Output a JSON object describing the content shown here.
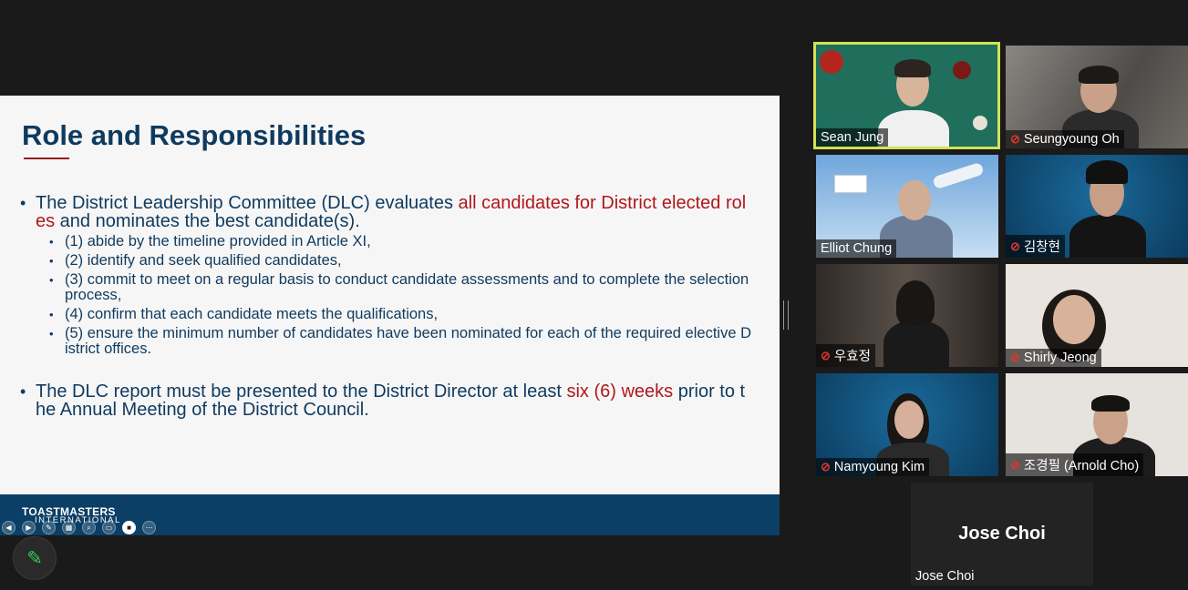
{
  "slide": {
    "title": "Role and Responsibilities",
    "bullet1": {
      "lead": "The District Leadership Committee (DLC) evaluates ",
      "highlight": "all candidates for District elected roles",
      "tail": " and nominates the best candidate(s)."
    },
    "subbullets": [
      "(1) abide by the timeline provided in Article XI,",
      "(2) identify and seek qualified candidates,",
      "(3) commit to meet on a regular basis to conduct candidate assessments and to complete the selection process,",
      "(4) confirm that each candidate meets the qualifications,",
      "(5) ensure the minimum number of candidates have been nominated for each of the required elective District offices."
    ],
    "bullet2": {
      "lead": "The DLC report must be presented to the District Director at least ",
      "highlight": "six (6) weeks",
      "tail": " prior to the Annual Meeting of the District Council."
    },
    "footer_logo_top": "TOASTMASTERS",
    "footer_logo_bottom": "INTERNATIONAL"
  },
  "participants": [
    {
      "name": "Sean Jung",
      "muted": false,
      "active_speaker": true
    },
    {
      "name": "Seungyoung Oh",
      "muted": true
    },
    {
      "name": "Elliot Chung",
      "muted": false
    },
    {
      "name": "김창현",
      "muted": true
    },
    {
      "name": "우효정",
      "muted": true
    },
    {
      "name": "Shirly Jeong",
      "muted": true
    },
    {
      "name": "Namyoung Kim",
      "muted": true
    },
    {
      "name": "조경필 (Arnold Cho)",
      "muted": true
    },
    {
      "name": "Jose Choi",
      "muted": false,
      "video_off": true,
      "center_label": "Jose Choi"
    }
  ],
  "colors": {
    "title": "#0f3a5f",
    "highlight": "#b0171c",
    "footer": "#0b3f66",
    "active_border": "#d4e157",
    "muted_icon": "#e0352b"
  },
  "icons": {
    "annotate": "pencil-icon",
    "muted": "mic-off-icon"
  }
}
